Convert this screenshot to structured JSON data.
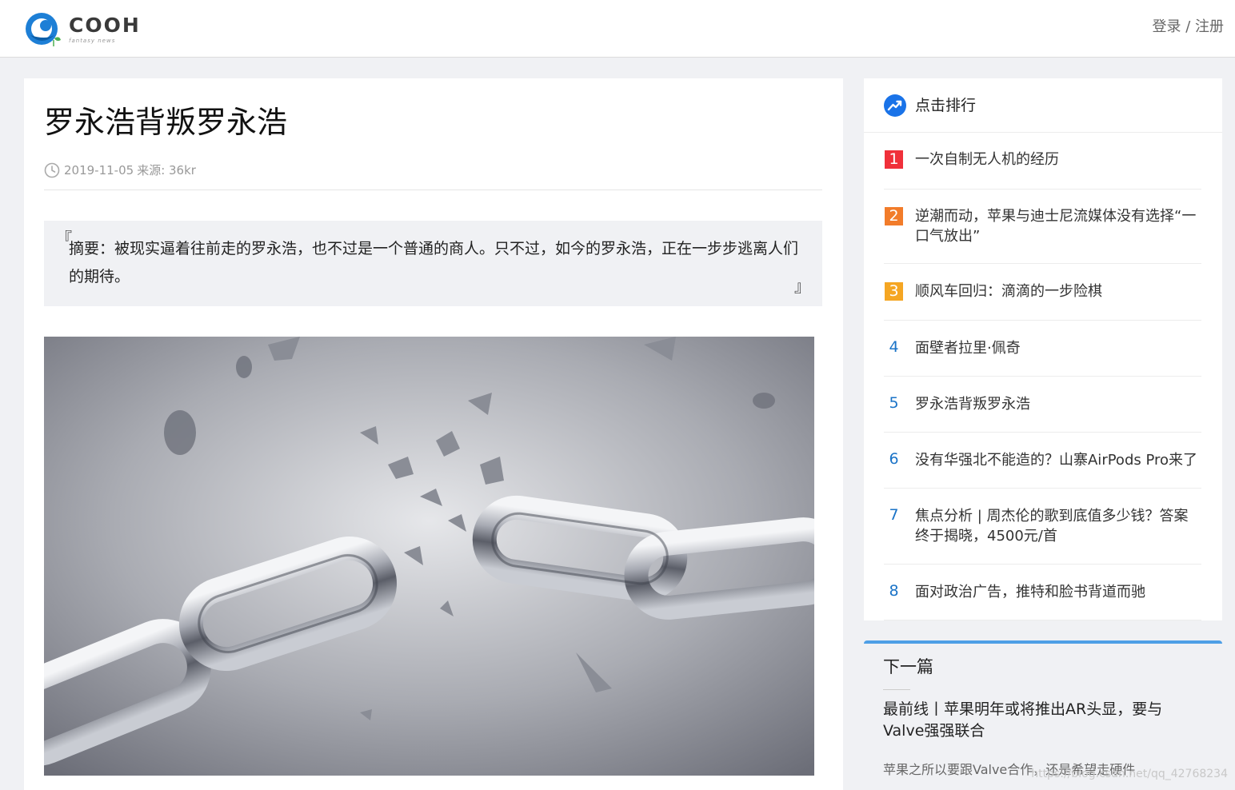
{
  "header": {
    "logo_text": "COOH",
    "logo_sub": "fantasy news",
    "login_label": "登录",
    "auth_sep": " / ",
    "register_label": "注册"
  },
  "article": {
    "title": "罗永浩背叛罗永浩",
    "date": "2019-11-05",
    "source": "来源: 36kr",
    "summary_open": "『",
    "summary_close": "』",
    "summary": "摘要：被现实逼着往前走的罗永浩，也不过是一个普通的商人。只不过，如今的罗永浩，正在一步步逃离人们的期待。"
  },
  "ranking": {
    "title": "点击排行",
    "items": [
      {
        "num": "1",
        "title": "一次自制无人机的经历"
      },
      {
        "num": "2",
        "title": "逆潮而动，苹果与迪士尼流媒体没有选择“一口气放出”"
      },
      {
        "num": "3",
        "title": "顺风车回归：滴滴的一步险棋"
      },
      {
        "num": "4",
        "title": "面壁者拉里·佩奇"
      },
      {
        "num": "5",
        "title": "罗永浩背叛罗永浩"
      },
      {
        "num": "6",
        "title": "没有华强北不能造的？山寨AirPods Pro来了"
      },
      {
        "num": "7",
        "title": "焦点分析 | 周杰伦的歌到底值多少钱？答案终于揭晓，4500元/首"
      },
      {
        "num": "8",
        "title": "面对政治广告，推特和脸书背道而驰"
      }
    ]
  },
  "next": {
    "label": "下一篇",
    "title": "最前线丨苹果明年或将推出AR头显，要与Valve强强联合",
    "excerpt": "苹果之所以要跟Valve合作，还是希望走硬件"
  },
  "watermark": "https://blog.csdn.net/qq_42768234",
  "colors": {
    "accent": "#4e9fe6",
    "rank1": "#f0303a",
    "rank2": "#f27c2a",
    "rank3": "#f5a623",
    "rank_num": "#1a73c7"
  },
  "icons": {
    "logo": "cooh-logo-icon",
    "clock": "clock-icon",
    "trend": "trending-up-icon"
  }
}
